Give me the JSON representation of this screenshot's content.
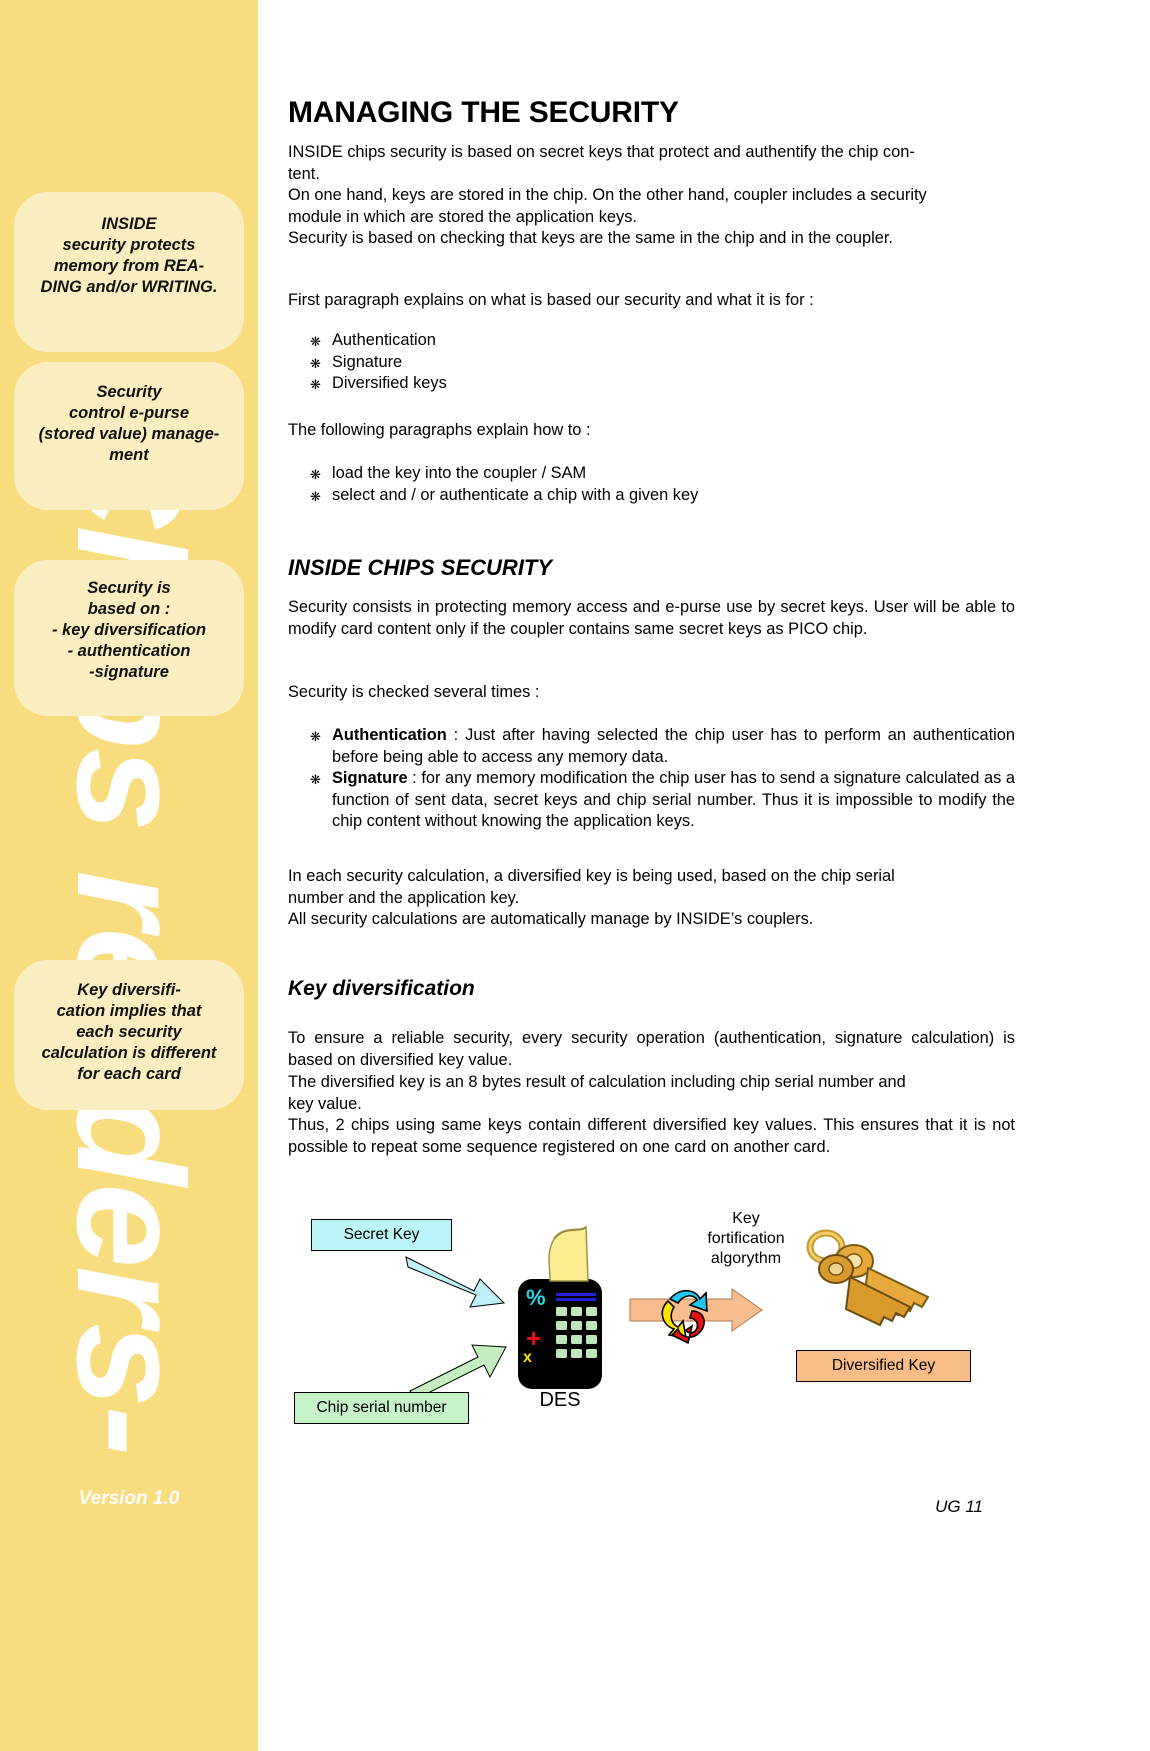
{
  "sidebar": {
    "watermark": "Chips readers-",
    "callouts": [
      {
        "id": "callout-1",
        "text": "INSIDE\nsecurity protects\nmemory from REA-\nDING and/or WRITING."
      },
      {
        "id": "callout-2",
        "text": "Security\ncontrol e-purse\n(stored value) manage-\nment"
      },
      {
        "id": "callout-3",
        "text": "Security is\nbased on :\n- key diversification\n- authentication\n-signature"
      },
      {
        "id": "callout-4",
        "text": "Key diversifi-\ncation implies that\neach security\ncalculation is different\nfor each card"
      }
    ],
    "version": "Version 1.0"
  },
  "main": {
    "title": "MANAGING THE SECURITY",
    "intro_paragraph": "INSIDE chips security is based on secret keys that protect and authentify the chip con-tent.\nOn one hand, keys are stored in the chip. On the other hand, coupler includes a security module in which are stored the application keys.\nSecurity is based on checking that keys are the same in the chip and in the coupler.",
    "intro_p1_line1": "INSIDE chips security is based on secret keys that protect and authentify the chip con-",
    "intro_p1_line2": "tent.",
    "intro_p2_line1": "On one hand, keys are stored in the chip. On the other hand, coupler includes a security",
    "intro_p2_line2": "module in which are stored the application keys.",
    "intro_p3": "Security is based on checking that keys are the same in the chip and in the coupler.",
    "first_paragraph_intro": "First paragraph explains on what is based our security and what it is for :",
    "list_one": [
      "Authentication",
      "Signature",
      "Diversified keys"
    ],
    "following_paragraphs_intro": "The following paragraphs explain how to :",
    "list_two": [
      "load the key into the coupler / SAM",
      "select and / or authenticate a chip with a given key"
    ],
    "section_heading": "INSIDE CHIPS SECURITY",
    "section_para": "Security consists in protecting memory access and e-purse use by secret keys. User will be able to modify card content only if the coupler contains same secret keys as PICO chip.",
    "security_checked_intro": "Security is checked several times :",
    "security_items": [
      {
        "lead": "Authentication",
        "rest": " : Just after having selected the chip user has to perform an authentication before being able to access any memory data."
      },
      {
        "lead": "Signature",
        "rest": " : for any memory modification the chip user has to send a signature calculated as a function of sent data, secret keys and chip serial number. Thus it is impossible to modify the chip content without knowing the application keys."
      }
    ],
    "diversified_para_line1": "In each security calculation, a diversified key is being used, based on the chip serial",
    "diversified_para_line2": "number and  the application key.",
    "diversified_para_line3": "All security calculations are automatically manage by INSIDE’s couplers.",
    "subsection_heading": "Key diversification",
    "keydiv_para1": "To ensure a reliable security, every security operation (authentication, signature calculation) is based on diversified key value.",
    "keydiv_para2_line1": "The diversified key is an 8 bytes result of calculation including chip serial number and",
    "keydiv_para2_line2": "key value.",
    "keydiv_para3": "Thus, 2 chips using same keys contain different diversified key values. This ensures that it is not possible to repeat some sequence registered on one card on another card."
  },
  "diagram": {
    "secret_key_box": "Secret Key",
    "chip_serial_box": "Chip serial number",
    "diversified_key_box": "Diversified Key",
    "key_algorithm_label": "Key\nfortification\nalgorythm",
    "des_label": "DES",
    "colors": {
      "secret_key_fill": "#bbf4f7",
      "chip_serial_fill": "#c6f2c9",
      "diversified_key_fill": "#f8bd87",
      "arrow_cyan": "#bff0f5",
      "arrow_green": "#c6edc2",
      "arrow_orange": "#f7bd8e",
      "calculator_body": "#000000",
      "paper": "#faee90",
      "key_gold": "#e8a93c"
    }
  },
  "footer": {
    "page_ref": "UG 11"
  }
}
